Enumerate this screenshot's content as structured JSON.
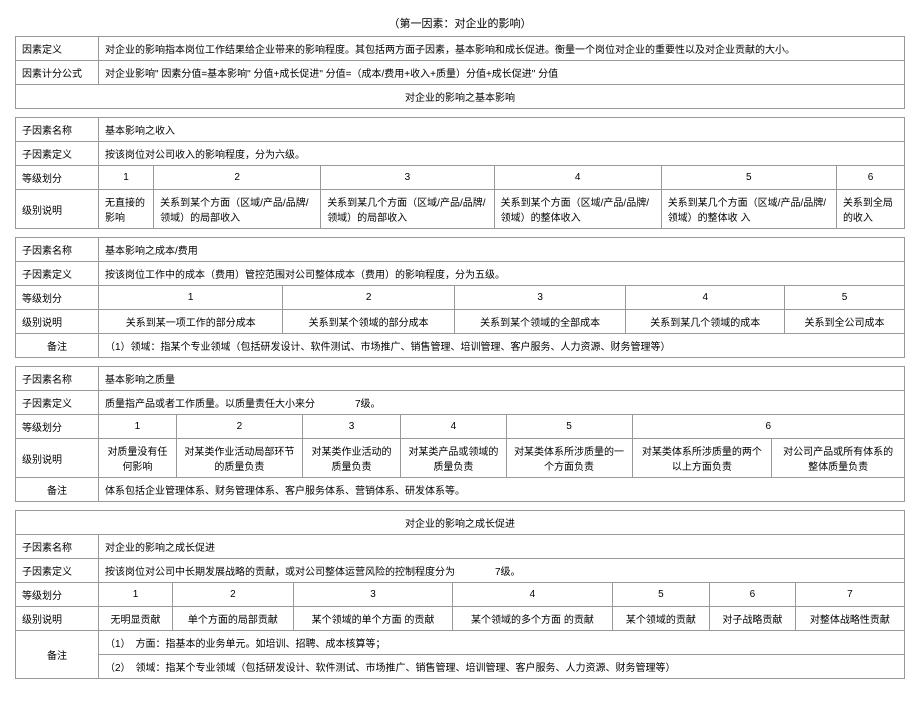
{
  "title": "（第一因素：对企业的影响）",
  "top": {
    "r1_label": "因素定义",
    "r1_content": "对企业的影响指本岗位工作结果给企业带来的影响程度。其包括两方面子因素，基本影响和成长促进。衡量一个岗位对企业的重要性以及对企业贡献的大小。",
    "r2_label": "因素计分公式",
    "r2_content": "对企业影响\" 因素分值=基本影响\" 分值+成长促进\" 分值=（成本/费用+收入+质量）分值+成长促进\" 分值"
  },
  "sec1_header": "对企业的影响之基本影响",
  "sec1": {
    "name_label": "子因素名称",
    "name_val": "基本影响之收入",
    "def_label": "子因素定义",
    "def_val": "按该岗位对公司收入的影响程度，分为六级。",
    "grade_label": "等级划分",
    "nums": [
      "1",
      "2",
      "3",
      "4",
      "5",
      "6"
    ],
    "desc_label": "级别说明",
    "descs": [
      "无直接的影响",
      "关系到某个方面（区域/产品/品牌/领域）的局部收入",
      "关系到某几个方面（区域/产品/品牌/领域）的局部收入",
      "关系到某个方面（区域/产品/品牌/领域）的整体收入",
      "关系到某几个方面（区域/产品/品牌/领域）的整体收 入",
      "关系到全局的收入"
    ]
  },
  "sec2": {
    "name_label": "子因素名称",
    "name_val": "基本影响之成本/费用",
    "def_label": "子因素定义",
    "def_val": "按该岗位工作中的成本（费用）管控范围对公司整体成本（费用）的影响程度，分为五级。",
    "grade_label": "等级划分",
    "nums": [
      "1",
      "2",
      "3",
      "4",
      "5"
    ],
    "desc_label": "级别说明",
    "descs": [
      "关系到某一项工作的部分成本",
      "关系到某个领域的部分成本",
      "关系到某个领域的全部成本",
      "关系到某几个领域的成本",
      "关系到全公司成本"
    ],
    "note_label": "备注",
    "note_content": "（1）领域：指某个专业领域（包括研发设计、软件测试、市场推广、销售管理、培训管理、客户服务、人力资源、财务管理等）"
  },
  "sec3": {
    "name_label": "子因素名称",
    "name_val": "基本影响之质量",
    "def_label": "子因素定义",
    "def_val": "质量指产品或者工作质量。以质量责任大小来分　　　　7级。",
    "grade_label": "等级划分",
    "nums": [
      "1",
      "2",
      "3",
      "4",
      "5",
      "6"
    ],
    "desc_label": "级别说明",
    "descs": [
      "对质量没有任何影响",
      "对某类作业活动局部环节的质量负责",
      "对某类作业活动的质量负责",
      "对某类产品或领域的质量负责",
      "对某类体系所涉质量的一个方面负责",
      "对某类体系所涉质量的两个以上方面负责",
      "对公司产品或所有体系的整体质量负责"
    ],
    "note_label": "备注",
    "note_content": "体系包括企业管理体系、财务管理体系、客户服务体系、营销体系、研发体系等。"
  },
  "sec4_header": "对企业的影响之成长促进",
  "sec4": {
    "name_label": "子因素名称",
    "name_val": "对企业的影响之成长促进",
    "def_label": "子因素定义",
    "def_val": "按该岗位对公司中长期发展战略的贡献，或对公司整体运营风险的控制程度分为　　　　7级。",
    "grade_label": "等级划分",
    "nums": [
      "1",
      "2",
      "3",
      "4",
      "5",
      "6",
      "7"
    ],
    "desc_label": "级别说明",
    "descs": [
      "无明显贡献",
      "单个方面的局部贡献",
      "某个领域的单个方面 的贡献",
      "某个领域的多个方面 的贡献",
      "某个领域的贡献",
      "对子战略贡献",
      "对整体战略性贡献"
    ],
    "note_label": "备注",
    "note_line1": "（1）　方面：指基本的业务单元。如培训、招聘、成本核算等；",
    "note_line2": "（2）　领域：指某个专业领域（包括研发设计、软件测试、市场推广、销售管理、培训管理、客户服务、人力资源、财务管理等）"
  }
}
